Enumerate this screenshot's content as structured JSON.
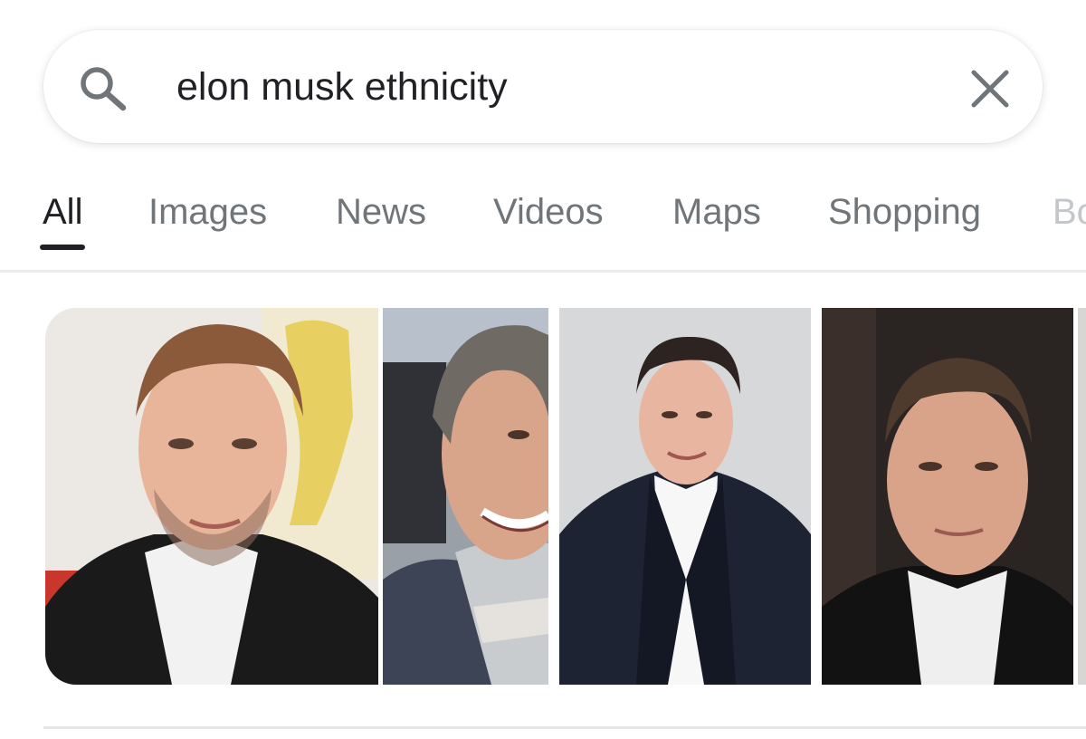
{
  "search": {
    "query": "elon musk ethnicity",
    "icon": "search-icon",
    "clear_icon": "close-icon"
  },
  "tabs": [
    {
      "label": "All",
      "active": true
    },
    {
      "label": "Images",
      "active": false
    },
    {
      "label": "News",
      "active": false
    },
    {
      "label": "Videos",
      "active": false
    },
    {
      "label": "Maps",
      "active": false
    },
    {
      "label": "Shopping",
      "active": false
    },
    {
      "label": "Bo",
      "active": false
    }
  ],
  "colors": {
    "active_tab": "#202124",
    "inactive_tab": "#70757a",
    "icon_gray": "#70757a"
  },
  "image_results": [
    {
      "kind": "photo",
      "subject": "man-portrait-dark-jacket"
    },
    {
      "kind": "photo",
      "subject": "smiling-man-scarf"
    },
    {
      "kind": "photo",
      "subject": "man-navy-suit"
    },
    {
      "kind": "photo",
      "subject": "man-black-jacket"
    }
  ]
}
